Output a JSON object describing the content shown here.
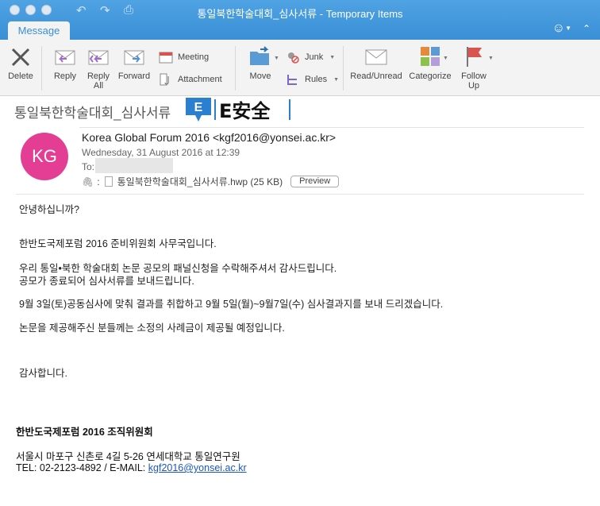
{
  "window": {
    "title": "통일북한학술대회_심사서류 - Temporary Items",
    "tab": "Message"
  },
  "ribbon": {
    "delete": "Delete",
    "reply": "Reply",
    "reply_all_1": "Reply",
    "reply_all_2": "All",
    "forward": "Forward",
    "meeting": "Meeting",
    "attachment": "Attachment",
    "move": "Move",
    "junk": "Junk",
    "rules": "Rules",
    "read_unread": "Read/Unread",
    "categorize": "Categorize",
    "follow_up_1": "Follow",
    "follow_up_2": "Up"
  },
  "email": {
    "subject": "통일북한학술대회_심사서류",
    "logo_text": "E安全",
    "avatar_initials": "KG",
    "sender": "Korea Global Forum 2016 <kgf2016@yonsei.ac.kr>",
    "date": "Wednesday, 31 August 2016 at 12:39",
    "to_label": "To:",
    "attachment_sep": ":",
    "attachment_name": "통일북한학술대회_심사서류.hwp (25 KB)",
    "preview_label": "Preview",
    "colors": {
      "avatar": "#e33e94",
      "titlebar": "#3a8fd6",
      "link": "#1a56c9"
    }
  },
  "body": {
    "greeting": "안녕하십니까?",
    "line1": "한반도국제포럼 2016 준비위원회 사무국입니다.",
    "line2": "우리 통일•북한 학술대회 논문 공모의 패널신청을 수락해주셔서 감사드립니다.",
    "line3": "공모가 종료되어 심사서류를 보내드립니다.",
    "line4": "9월 3일(토)공동심사에 맞춰 결과를 취합하고 9월 5일(월)~9월7일(수) 심사결과지를 보내 드리겠습니다.",
    "line5": "논문을 제공해주신 분들께는 소정의 사례금이 제공될 예정입니다.",
    "thanks": "감사합니다."
  },
  "signature": {
    "org": "한반도국제포럼 2016 조직위원회",
    "address": "서울시 마포구 신촌로 4길 5-26 연세대학교 통일연구원",
    "contact_prefix": "TEL: 02-2123-4892 / E-MAIL: ",
    "email": "kgf2016@yonsei.ac.kr"
  }
}
